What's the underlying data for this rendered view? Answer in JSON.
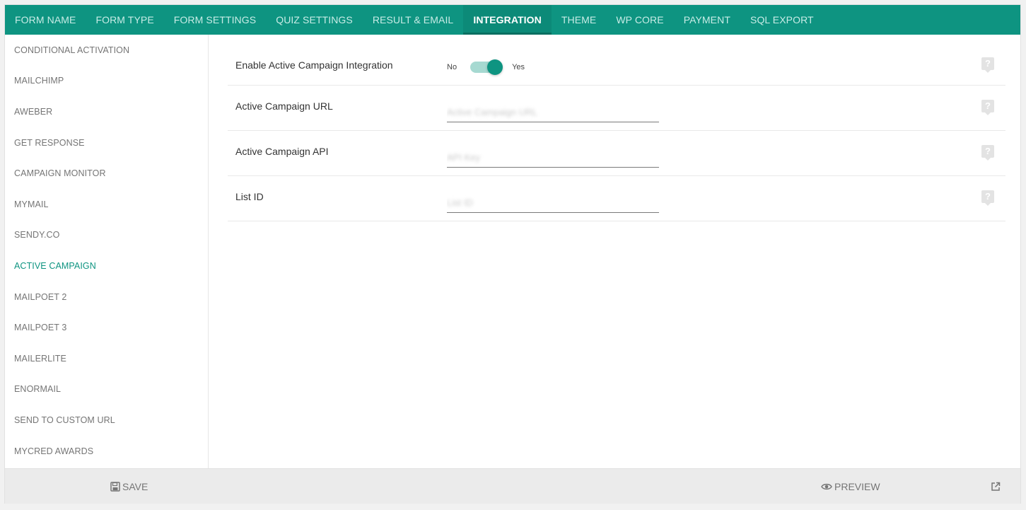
{
  "topnav": {
    "tabs": [
      {
        "label": "FORM NAME"
      },
      {
        "label": "FORM TYPE"
      },
      {
        "label": "FORM SETTINGS"
      },
      {
        "label": "QUIZ SETTINGS"
      },
      {
        "label": "RESULT & EMAIL"
      },
      {
        "label": "INTEGRATION"
      },
      {
        "label": "THEME"
      },
      {
        "label": "WP CORE"
      },
      {
        "label": "PAYMENT"
      },
      {
        "label": "SQL EXPORT"
      }
    ],
    "active_index": 5
  },
  "sidebar": {
    "items": [
      {
        "label": "CONDITIONAL ACTIVATION"
      },
      {
        "label": "MAILCHIMP"
      },
      {
        "label": "AWEBER"
      },
      {
        "label": "GET RESPONSE"
      },
      {
        "label": "CAMPAIGN MONITOR"
      },
      {
        "label": "MYMAIL"
      },
      {
        "label": "SENDY.CO"
      },
      {
        "label": "ACTIVE CAMPAIGN"
      },
      {
        "label": "MAILPOET 2"
      },
      {
        "label": "MAILPOET 3"
      },
      {
        "label": "MAILERLITE"
      },
      {
        "label": "ENORMAIL"
      },
      {
        "label": "SEND TO CUSTOM URL"
      },
      {
        "label": "MYCRED AWARDS"
      }
    ],
    "active_index": 7
  },
  "main": {
    "enable": {
      "label": "Enable Active Campaign Integration",
      "no_label": "No",
      "yes_label": "Yes",
      "value": true
    },
    "url": {
      "label": "Active Campaign URL",
      "placeholder": "Active Campaign URL",
      "value": ""
    },
    "api": {
      "label": "Active Campaign API",
      "placeholder": "API Key",
      "value": ""
    },
    "list": {
      "label": "List ID",
      "placeholder": "List ID",
      "value": ""
    },
    "help_glyph": "?"
  },
  "footer": {
    "save_label": "SAVE",
    "preview_label": "PREVIEW"
  },
  "colors": {
    "accent": "#0e9481",
    "accent_light": "#a6d9d1",
    "footer_bg": "#ebebeb"
  },
  "icons": {
    "save": "floppy-disk-icon",
    "preview": "eye-icon",
    "external": "external-link-icon",
    "help": "question-bubble-icon"
  }
}
